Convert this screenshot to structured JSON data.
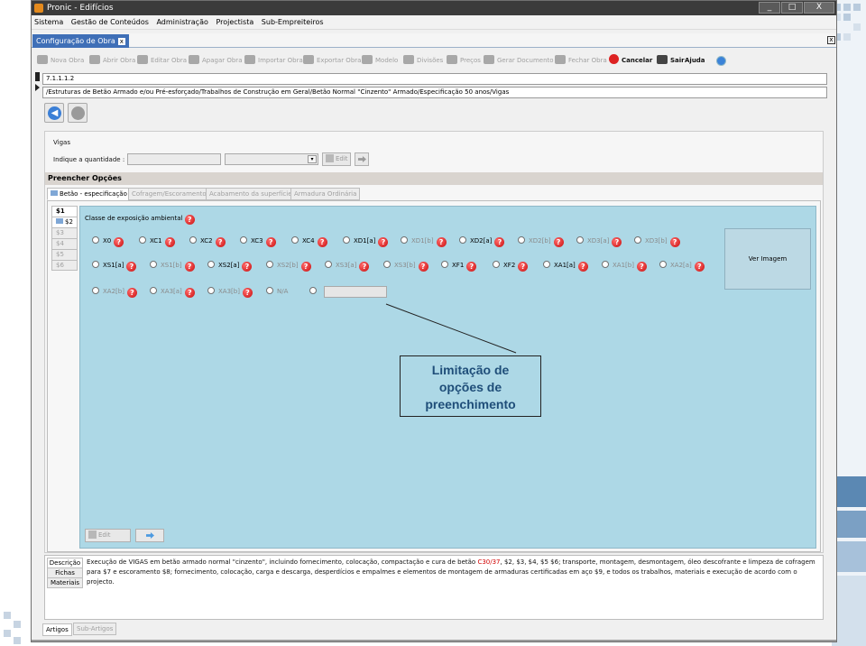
{
  "window": {
    "title": "Pronic - Edifícios",
    "controls": [
      "_",
      "□",
      "X"
    ]
  },
  "menubar": [
    "Sistema",
    "Gestão de Conteúdos",
    "Administração",
    "Projectista",
    "Sub-Empreiteiros"
  ],
  "doc_tab": {
    "label": "Configuração de Obra",
    "close": "x"
  },
  "toolbar": [
    {
      "label": "Nova Obra",
      "icon": "new-project-icon",
      "enabled": false
    },
    {
      "label": "Abrir Obra",
      "icon": "open-project-icon",
      "enabled": false
    },
    {
      "label": "Editar Obra",
      "icon": "edit-project-icon",
      "enabled": false
    },
    {
      "label": "Apagar Obra",
      "icon": "delete-project-icon",
      "enabled": false
    },
    {
      "label": "Importar Obra",
      "icon": "import-icon",
      "enabled": false
    },
    {
      "label": "Exportar Obra",
      "icon": "export-icon",
      "enabled": false
    },
    {
      "label": "Modelo",
      "icon": "model-icon",
      "enabled": false
    },
    {
      "label": "Divisões",
      "icon": "divisions-icon",
      "enabled": false
    },
    {
      "label": "Preços",
      "icon": "prices-icon",
      "enabled": false
    },
    {
      "label": "Gerar Documento",
      "icon": "document-icon",
      "enabled": false
    },
    {
      "label": "Fechar Obra",
      "icon": "close-project-icon",
      "enabled": false
    },
    {
      "label": "Cancelar",
      "icon": "cancel-icon",
      "enabled": true
    },
    {
      "label": "Sair",
      "icon": "exit-icon",
      "enabled": true
    },
    {
      "label": "Ajuda",
      "icon": "help-icon",
      "enabled": true
    }
  ],
  "code": "7.1.1.1.2",
  "path": "/Estruturas de Betão Armado e/ou Pré-esforçado/Trabalhos de Construção em Geral/Betão Normal \"Cinzento\" Armado/Especificação 50 anos/Vigas",
  "nav": {
    "back_icon": "back-arrow-icon",
    "forward_icon": "forward-arrow-icon"
  },
  "vigas": {
    "title": "Vigas",
    "quantity_label": "Indique a quantidade :",
    "edit_label": "Edit",
    "section_title": "Preencher Opções"
  },
  "subtabs": [
    "Betão - especificação",
    "Cofragem/Escoramento",
    "Acabamento da superfície",
    "Armadura Ordinária"
  ],
  "side_tabs": [
    "$1",
    "$2",
    "$3",
    "$4",
    "$5",
    "$6"
  ],
  "exposure": {
    "label": "Classe de exposição ambiental",
    "rows": [
      [
        {
          "text": "X0",
          "enabled": true
        },
        {
          "text": "XC1",
          "enabled": true
        },
        {
          "text": "XC2",
          "enabled": true
        },
        {
          "text": "XC3",
          "enabled": true
        },
        {
          "text": "XC4",
          "enabled": true
        },
        {
          "text": "XD1[a]",
          "enabled": true
        },
        {
          "text": "XD1[b]",
          "enabled": false
        },
        {
          "text": "XD2[a]",
          "enabled": true
        },
        {
          "text": "XD2[b]",
          "enabled": false
        },
        {
          "text": "XD3[a]",
          "enabled": false
        },
        {
          "text": "XD3[b]",
          "enabled": false
        }
      ],
      [
        {
          "text": "XS1[a]",
          "enabled": true
        },
        {
          "text": "XS1[b]",
          "enabled": false
        },
        {
          "text": "XS2[a]",
          "enabled": true
        },
        {
          "text": "XS2[b]",
          "enabled": false
        },
        {
          "text": "XS3[a]",
          "enabled": false
        },
        {
          "text": "XS3[b]",
          "enabled": false
        },
        {
          "text": "XF1",
          "enabled": true
        },
        {
          "text": "XF2",
          "enabled": true
        },
        {
          "text": "XA1[a]",
          "enabled": true
        },
        {
          "text": "XA1[b]",
          "enabled": false
        },
        {
          "text": "XA2[a]",
          "enabled": false
        }
      ],
      [
        {
          "text": "XA2[b]",
          "enabled": false
        },
        {
          "text": "XA3[a]",
          "enabled": false
        },
        {
          "text": "XA3[b]",
          "enabled": false
        },
        {
          "text": "N/A",
          "enabled": false
        }
      ]
    ],
    "view_image": "Ver Imagem",
    "edit_label": "Edit"
  },
  "description": {
    "tabs": [
      "Descrição",
      "Fichas",
      "Materiais"
    ],
    "text_before": "Execução de VIGAS em betão armado normal \"cinzento\", incluindo fornecimento, colocação, compactação e cura de betão ",
    "text_highlight": "C30/37",
    "text_after": ", $2, $3, $4, $5 $6; transporte, montagem, desmontagem, óleo descofrante e limpeza de cofragem para $7 e escoramento $8; fornecimento, colocação, carga e descarga, desperdícios e empalmes e elementos de montagem de armaduras certificadas em aço $9, e todos os trabalhos, materiais e execução de acordo com o projecto."
  },
  "bottom_tabs": [
    "Artigos",
    "Sub-Artigos"
  ],
  "annotation": {
    "line1": "Limitação de",
    "line2": "opções de",
    "line3": "preenchimento"
  },
  "colors": {
    "accent_blue": "#add8e6",
    "tab_blue": "#3f6fb7",
    "help_red": "#d22222",
    "annotation_text": "#1f4e79"
  }
}
